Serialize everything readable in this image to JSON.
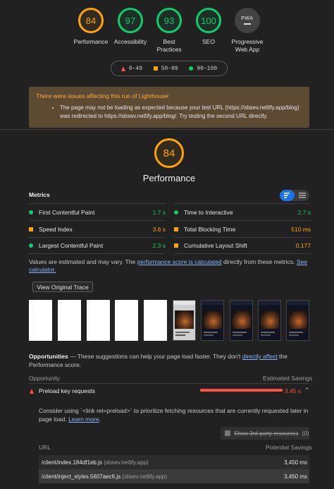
{
  "scores": [
    {
      "value": "84",
      "label": "Performance",
      "status": "average"
    },
    {
      "value": "97",
      "label": "Accessibility",
      "status": "pass"
    },
    {
      "value": "93",
      "label": "Best Practices",
      "status": "pass"
    },
    {
      "value": "100",
      "label": "SEO",
      "status": "pass"
    },
    {
      "value": "PWA",
      "label": "Progressive Web App",
      "status": "pwa"
    }
  ],
  "legend": {
    "fail": "0–49",
    "average": "50–89",
    "pass": "90–100"
  },
  "warning": {
    "title": "There were issues affecting this run of Lighthouse:",
    "item": "The page may not be loading as expected because your test URL (https://sbsev.netlify.app/blog) was redirected to https://sbsev.netlify.app/blog/. Try testing the second URL directly."
  },
  "performance": {
    "score": "84",
    "title": "Performance"
  },
  "metrics": {
    "title": "Metrics",
    "items": [
      {
        "name": "First Contentful Paint",
        "value": "1.7 s",
        "status": "pass"
      },
      {
        "name": "Time to Interactive",
        "value": "2.7 s",
        "status": "pass"
      },
      {
        "name": "Speed Index",
        "value": "3.6 s",
        "status": "average"
      },
      {
        "name": "Total Blocking Time",
        "value": "510 ms",
        "status": "average"
      },
      {
        "name": "Largest Contentful Paint",
        "value": "2.3 s",
        "status": "pass"
      },
      {
        "name": "Cumulative Layout Shift",
        "value": "0.177",
        "status": "average"
      }
    ]
  },
  "note": {
    "pre": "Values are estimated and may vary. The ",
    "link1": "performance score is calculated",
    "mid": " directly from these metrics. ",
    "link2": "See calculator."
  },
  "trace_button": "View Original Trace",
  "opportunities": {
    "title": "Opportunities",
    "text_pre": " — These suggestions can help your page load faster. They don't ",
    "link": "directly affect",
    "text_post": " the Performance score.",
    "col_left": "Opportunity",
    "col_right": "Estimated Savings"
  },
  "audit": {
    "name": "Preload key requests",
    "savings": "3.45 s",
    "description_pre": "Consider using `<link rel=preload>` to prioritize fetching resources that are currently requested later in page load. ",
    "description_link": "Learn more",
    "description_post": ".",
    "third_party": "Show 3rd-party resources",
    "third_party_count": "(0)",
    "col_url": "URL",
    "col_savings": "Potential Savings",
    "rows": [
      {
        "url": "/client/index.184df1eb.js",
        "host": "(sbsev.netlify.app)",
        "savings": "3,450 ms"
      },
      {
        "url": "/client/inject_styles.5607aec6.js",
        "host": "(sbsev.netlify.app)",
        "savings": "3,450 ms"
      }
    ]
  }
}
